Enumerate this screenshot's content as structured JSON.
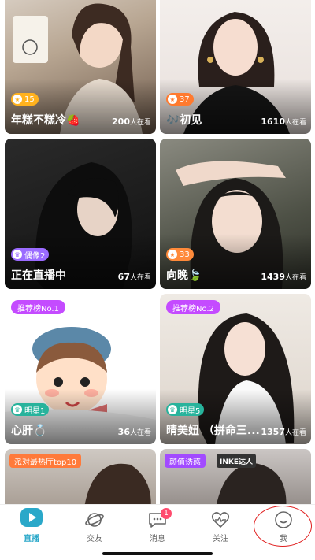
{
  "cards": [
    {
      "title": "年糕不糕冷🍓",
      "viewers": "200",
      "viewers_unit": "人在看",
      "level": "15",
      "level_color": "#ffb21e",
      "level_icon": "★"
    },
    {
      "title": "🎶初见",
      "viewers": "1610",
      "viewers_unit": "人在看",
      "level": "37",
      "level_color": "#ff7a2e",
      "level_icon": "★"
    },
    {
      "title": "正在直播中",
      "viewers": "67",
      "viewers_unit": "人在看",
      "level": "偶像2",
      "level_color": "#9b6bff",
      "level_icon": "♛"
    },
    {
      "title": "向晚🍃",
      "viewers": "1439",
      "viewers_unit": "人在看",
      "level": "33",
      "level_color": "#ff8a3a",
      "level_icon": "★"
    },
    {
      "title": "心肝💍",
      "viewers": "36",
      "viewers_unit": "人在看",
      "level": "明星1",
      "level_color": "#27b39c",
      "level_icon": "♛",
      "rank": "推荐榜No.1"
    },
    {
      "title": "晴美妞 （拼命三...",
      "viewers": "1357",
      "viewers_unit": "人在看",
      "level": "明星5",
      "level_color": "#27b39c",
      "level_icon": "♛",
      "rank": "推荐榜No.2"
    },
    {
      "promo": "派对最热厅top10",
      "promo_color": "#ff7a3a"
    },
    {
      "promo": "颜值诱惑",
      "promo_color": "#a24bff",
      "promo_extra": "INKE达人"
    }
  ],
  "tabs": [
    {
      "label": "直播",
      "active": true
    },
    {
      "label": "交友"
    },
    {
      "label": "消息",
      "badge": "1"
    },
    {
      "label": "关注"
    },
    {
      "label": "我"
    }
  ]
}
